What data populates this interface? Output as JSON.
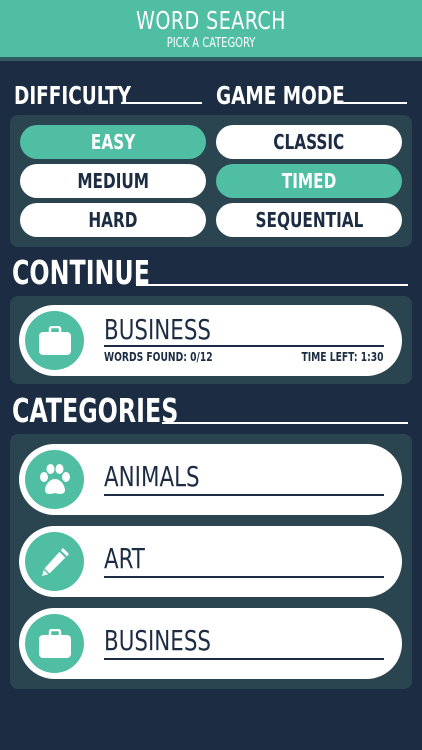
{
  "header": {
    "title": "WORD SEARCH",
    "subtitle": "PICK A CATEGORY"
  },
  "difficulty": {
    "label": "DIFFICULTY",
    "options": [
      "EASY",
      "MEDIUM",
      "HARD"
    ],
    "selected": "EASY"
  },
  "game_mode": {
    "label": "GAME MODE",
    "options": [
      "CLASSIC",
      "TIMED",
      "SEQUENTIAL"
    ],
    "selected": "TIMED"
  },
  "continue": {
    "label": "CONTINUE",
    "item": {
      "name": "BUSINESS",
      "icon": "briefcase-icon",
      "words_found": "WORDS FOUND: 0/12",
      "time_left": "TIME LEFT: 1:30"
    }
  },
  "categories": {
    "label": "CATEGORIES",
    "items": [
      {
        "name": "ANIMALS",
        "icon": "paw-icon"
      },
      {
        "name": "ART",
        "icon": "pencil-icon"
      },
      {
        "name": "BUSINESS",
        "icon": "briefcase-icon"
      }
    ]
  },
  "colors": {
    "accent": "#4fbea3",
    "background": "#1c2c42",
    "panel": "#2b4550",
    "text_dark": "#1c2c42"
  }
}
